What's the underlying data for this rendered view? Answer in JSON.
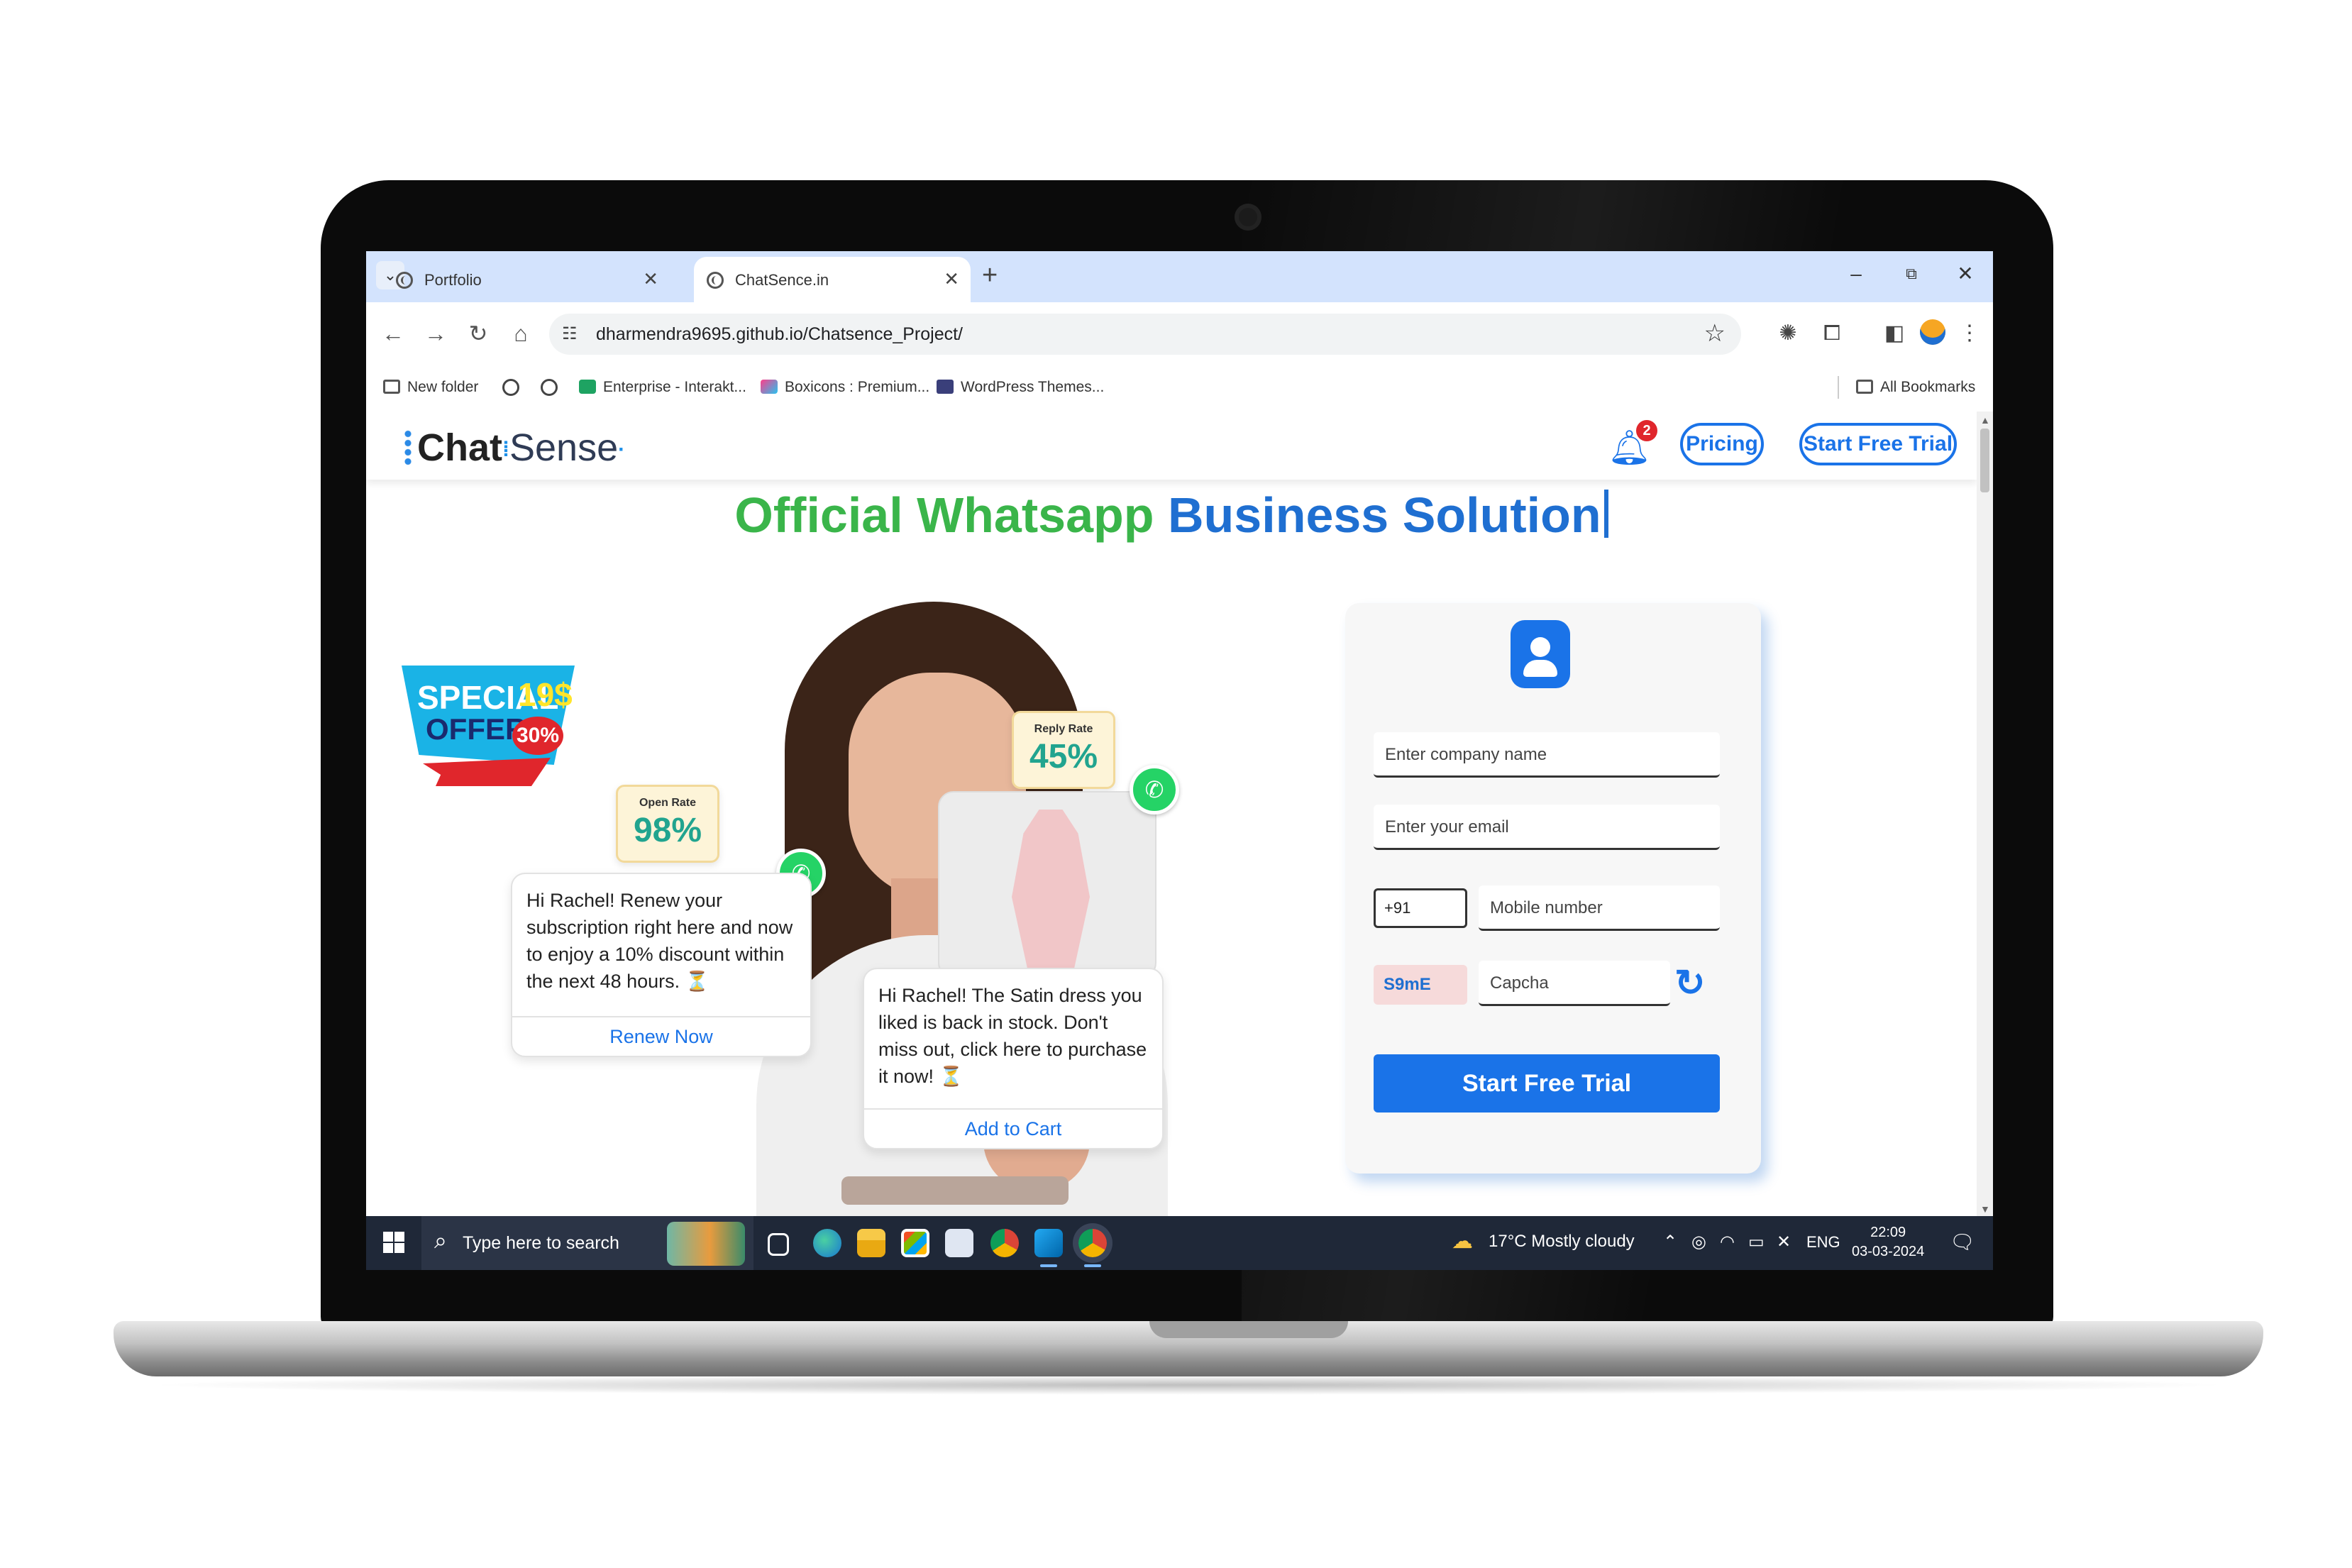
{
  "browser": {
    "tabs": [
      {
        "title": "Portfolio",
        "active": false
      },
      {
        "title": "ChatSence.in",
        "active": true
      }
    ],
    "new_tab": "+",
    "window_controls": {
      "minimize": "–",
      "restore": "⧉",
      "close": "✕"
    },
    "nav": {
      "back": "←",
      "forward": "→",
      "reload": "↻",
      "home": "⌂"
    },
    "url": "dharmendra9695.github.io/Chatsence_Project/",
    "bookmarks": [
      {
        "label": "New folder",
        "icon": "folder-icon"
      },
      {
        "label": "",
        "icon": "globe-icon"
      },
      {
        "label": "",
        "icon": "globe-icon"
      },
      {
        "label": "Enterprise - Interakt...",
        "icon": "interakt-icon"
      },
      {
        "label": "Boxicons : Premium...",
        "icon": "boxicons-icon"
      },
      {
        "label": "WordPress Themes...",
        "icon": "wordpress-icon"
      }
    ],
    "all_bookmarks": "All Bookmarks"
  },
  "site": {
    "logo_chat": "Chat",
    "logo_sense": "Sense",
    "notification_count": "2",
    "nav_buttons": {
      "pricing": "Pricing",
      "trial": "Start Free Trial"
    },
    "headline_green": "Official Whatsapp",
    "headline_blue": "Business Solution",
    "special_offer": {
      "line1": "SPECIAL",
      "line2": "OFFER",
      "price": "19$",
      "discount": "30%"
    },
    "stats": [
      {
        "label": "Open Rate",
        "value": "98%"
      },
      {
        "label": "Reply Rate",
        "value": "45%"
      }
    ],
    "bubbles": [
      {
        "message": "Hi Rachel! Renew your subscription right here and now to enjoy a 10% discount within the next 48 hours. ⏳",
        "action": "Renew Now"
      },
      {
        "message": "Hi Rachel! The Satin dress you liked is back in stock. Don't miss out, click here to purchase it now! ⏳",
        "action": "Add to Cart"
      }
    ],
    "form": {
      "company_placeholder": "Enter company name",
      "email_placeholder": "Enter your email",
      "country_code": "+91",
      "mobile_placeholder": "Mobile number",
      "captcha_code": "S9mE",
      "captcha_placeholder": "Capcha",
      "submit": "Start Free Trial"
    }
  },
  "taskbar": {
    "search_placeholder": "Type here to search",
    "weather": "17°C  Mostly cloudy",
    "language": "ENG",
    "time": "22:09",
    "date": "03-03-2024"
  },
  "colors": {
    "brand_blue": "#1a73e8",
    "headline_green": "#3ab54a",
    "whatsapp_green": "#25d366",
    "badge_red": "#e0262c"
  }
}
